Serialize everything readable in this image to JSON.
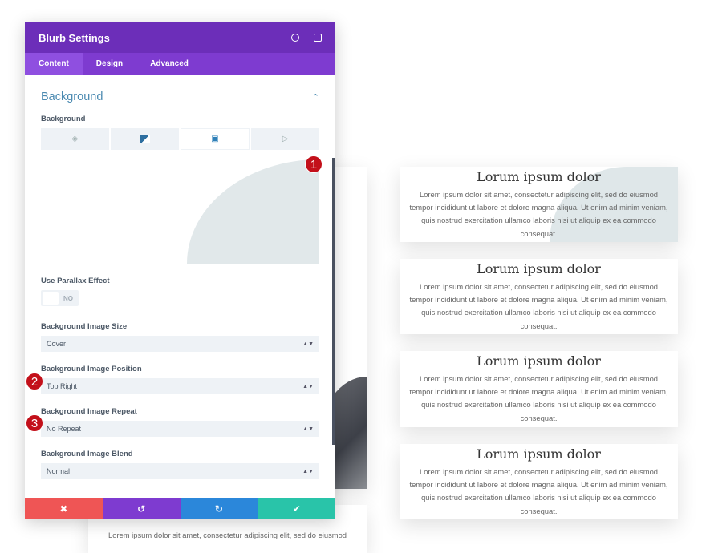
{
  "panel": {
    "title": "Blurb Settings",
    "header_icons": [
      "fullscreen-icon",
      "split-view-icon"
    ],
    "tabs": [
      {
        "label": "Content",
        "active": true
      },
      {
        "label": "Design"
      },
      {
        "label": "Advanced"
      }
    ],
    "section_title": "Background",
    "background_label": "Background",
    "background_types": [
      "color-icon",
      "gradient-icon",
      "image-icon",
      "video-icon"
    ],
    "active_background_type": "image",
    "parallax": {
      "label": "Use Parallax Effect",
      "value": "NO"
    },
    "image_size": {
      "label": "Background Image Size",
      "value": "Cover"
    },
    "image_position": {
      "label": "Background Image Position",
      "value": "Top Right"
    },
    "image_repeat": {
      "label": "Background Image Repeat",
      "value": "No Repeat"
    },
    "image_blend": {
      "label": "Background Image Blend",
      "value": "Normal"
    },
    "footer": {
      "cancel": "✖",
      "undo": "↺",
      "redo": "↻",
      "save": "✔"
    },
    "colors": {
      "header": "#6c2eb9",
      "cancel": "#ef5555",
      "undo": "#7e3bd0",
      "redo": "#2b87da",
      "save": "#29c4a9"
    }
  },
  "badges": [
    "1",
    "2",
    "3"
  ],
  "cards": [
    {
      "title": "Lorum ipsum dolor",
      "text": "Lorem ipsum dolor sit amet, consectetur adipiscing elit, sed do eiusmod tempor incididunt ut labore et dolore magna aliqua. Ut enim ad minim veniam, quis nostrud exercitation ullamco laboris nisi ut aliquip ex ea commodo consequat."
    },
    {
      "title": "Lorum ipsum dolor",
      "text": "Lorem ipsum dolor sit amet, consectetur adipiscing elit, sed do eiusmod tempor incididunt ut labore et dolore magna aliqua. Ut enim ad minim veniam, quis nostrud exercitation ullamco laboris nisi ut aliquip ex ea commodo consequat."
    },
    {
      "title": "Lorum ipsum dolor",
      "text": "Lorem ipsum dolor sit amet, consectetur adipiscing elit, sed do eiusmod tempor incididunt ut labore et dolore magna aliqua. Ut enim ad minim veniam, quis nostrud exercitation ullamco laboris nisi ut aliquip ex ea commodo consequat."
    },
    {
      "title": "Lorum ipsum dolor",
      "text": "Lorem ipsum dolor sit amet, consectetur adipiscing elit, sed do eiusmod tempor incididunt ut labore et dolore magna aliqua. Ut enim ad minim veniam, quis nostrud exercitation ullamco laboris nisi ut aliquip ex ea commodo consequat."
    }
  ],
  "behind_card_text": "Lorem ipsum dolor sit amet, consectetur adipiscing elit, sed do eiusmod"
}
